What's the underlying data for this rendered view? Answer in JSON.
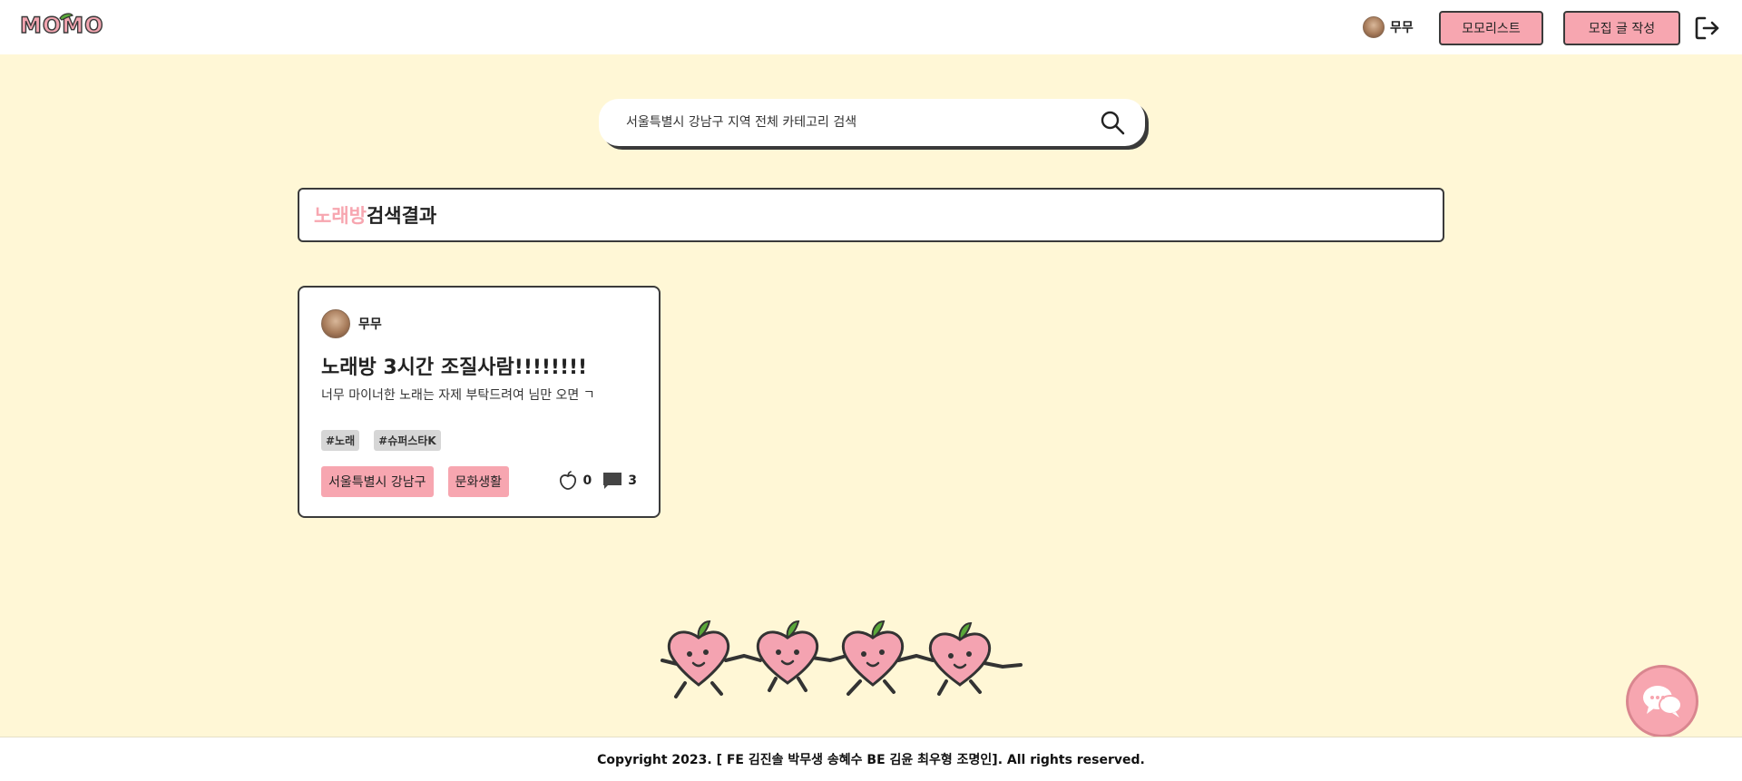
{
  "header": {
    "logo_text": "MOMO",
    "user_name": "무무",
    "momolist_label": "모모리스트",
    "write_label": "모집 글 작성",
    "logout_icon": "logout-icon"
  },
  "search": {
    "placeholder": "서울특별시 강남구 지역 전체 카테고리 검색",
    "icon": "search-icon"
  },
  "result": {
    "keyword": "노래방",
    "suffix": "검색결과"
  },
  "posts": [
    {
      "author": "무무",
      "title": "노래방 3시간 조질사람!!!!!!!!",
      "description": "너무 마이너한 노래는 자제 부탁드려여 님만 오면 ㄱ",
      "tags": [
        "#노래",
        "#슈퍼스타K"
      ],
      "location": "서울특별시 강남구",
      "category": "문화생활",
      "likes": "0",
      "comments": "3"
    }
  ],
  "footer": {
    "text": "Copyright 2023. [ FE 김진솔 박무생 송혜수 BE 김윤 최우형 조명인]. All rights reserved."
  },
  "colors": {
    "background": "#fff7d6",
    "accent_pink": "#f7a6b0",
    "border": "#3b3b3b",
    "tag_gray": "#d6d6d6"
  }
}
